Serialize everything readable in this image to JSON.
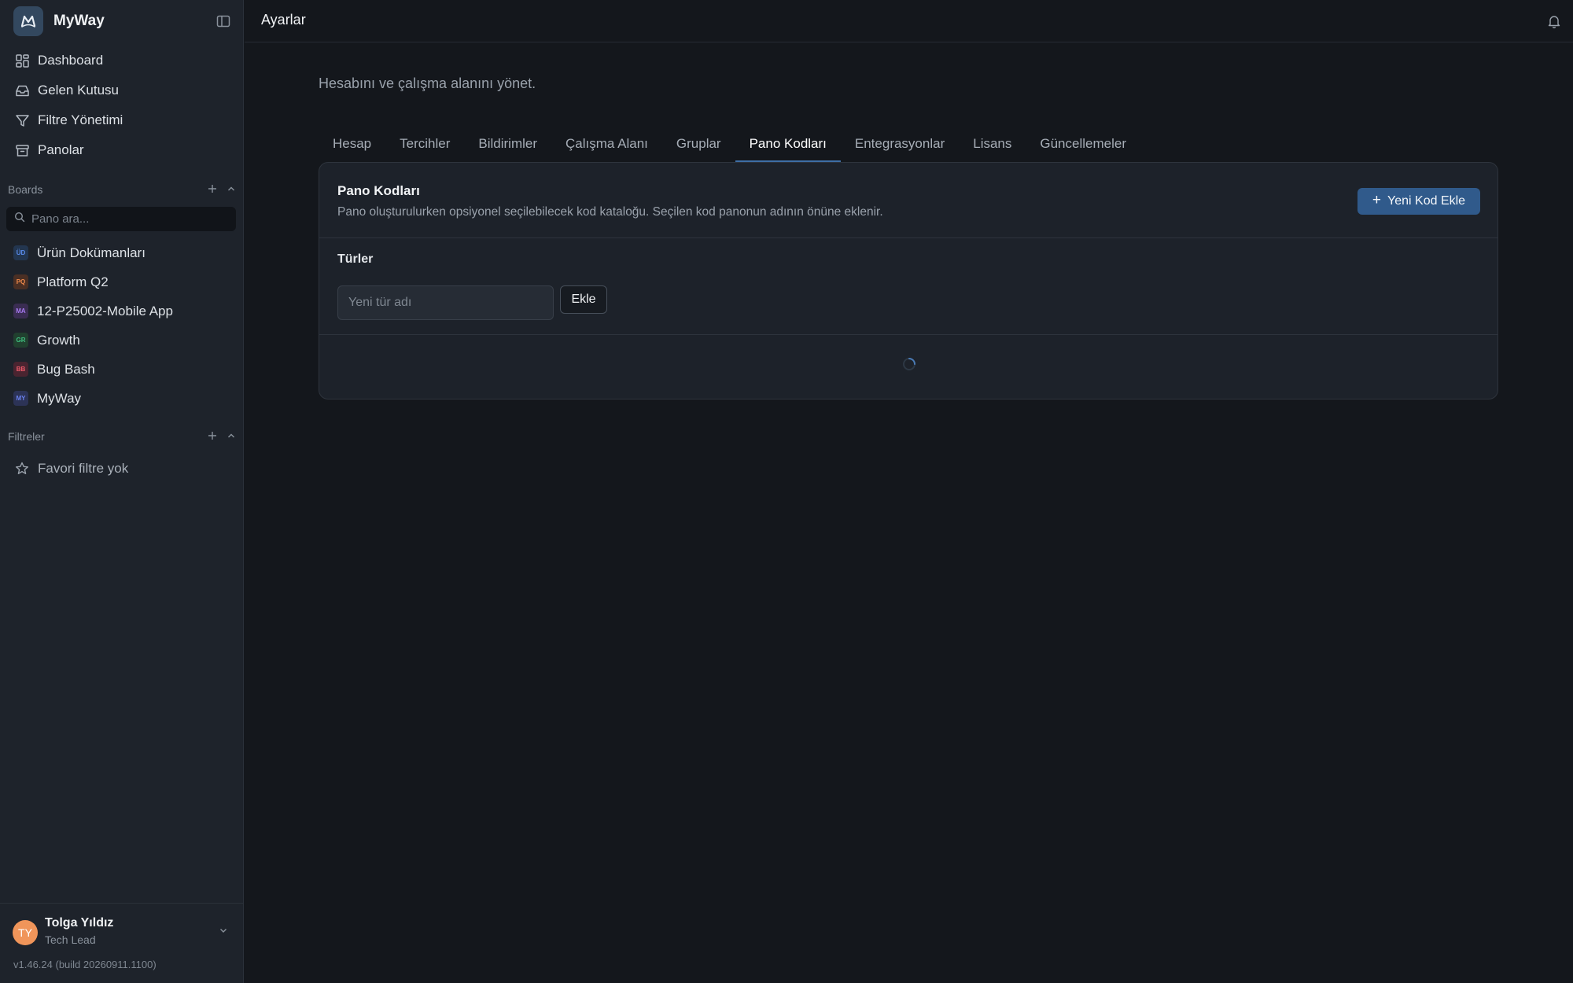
{
  "app": {
    "name": "MyWay",
    "logo_icon": "myway-logo-icon"
  },
  "sidebar": {
    "nav": [
      {
        "label": "Dashboard",
        "icon": "grid-icon"
      },
      {
        "label": "Gelen Kutusu",
        "icon": "inbox-icon"
      },
      {
        "label": "Filtre Yönetimi",
        "icon": "filter-icon"
      },
      {
        "label": "Panolar",
        "icon": "archive-icon"
      }
    ],
    "boards_section": {
      "title": "Boards"
    },
    "board_search": {
      "placeholder": "Pano ara..."
    },
    "boards": [
      {
        "code": "ÜD",
        "label": "Ürün Dokümanları",
        "color": "#5b8def",
        "bg": "#233650"
      },
      {
        "code": "PQ",
        "label": "Platform Q2",
        "color": "#f08a4b",
        "bg": "#4a2f24"
      },
      {
        "code": "MA",
        "label": "12-P25002-Mobile App",
        "color": "#a779f0",
        "bg": "#3a2d52"
      },
      {
        "code": "GR",
        "label": "Growth",
        "color": "#3fbf7f",
        "bg": "#21402f"
      },
      {
        "code": "BB",
        "label": "Bug Bash",
        "color": "#ef5a6a",
        "bg": "#4a2430"
      },
      {
        "code": "MY",
        "label": "MyWay",
        "color": "#6b82f0",
        "bg": "#2c3356"
      }
    ],
    "filters_section": {
      "title": "Filtreler"
    },
    "favorites_empty": "Favori filtre yok",
    "user": {
      "initials": "TY",
      "name": "Tolga Yıldız",
      "role": "Tech Lead"
    },
    "version": "v1.46.24 (build 20260911.1100)"
  },
  "header": {
    "title": "Ayarlar"
  },
  "settings": {
    "subtitle": "Hesabını ve çalışma alanını yönet.",
    "tabs": [
      {
        "label": "Hesap",
        "active": false
      },
      {
        "label": "Tercihler",
        "active": false
      },
      {
        "label": "Bildirimler",
        "active": false
      },
      {
        "label": "Çalışma Alanı",
        "active": false
      },
      {
        "label": "Gruplar",
        "active": false
      },
      {
        "label": "Pano Kodları",
        "active": true
      },
      {
        "label": "Entegrasyonlar",
        "active": false
      },
      {
        "label": "Lisans",
        "active": false
      },
      {
        "label": "Güncellemeler",
        "active": false
      }
    ],
    "card": {
      "title": "Pano Kodları",
      "description": "Pano oluşturulurken opsiyonel seçilebilecek kod kataloğu. Seçilen kod panonun adının önüne eklenir.",
      "add_code_label": "Yeni Kod Ekle",
      "types_label": "Türler",
      "type_input_placeholder": "Yeni tür adı",
      "add_label": "Ekle"
    }
  },
  "colors": {
    "accent": "#305a8b",
    "tab_indicator": "#3e6ea6"
  }
}
